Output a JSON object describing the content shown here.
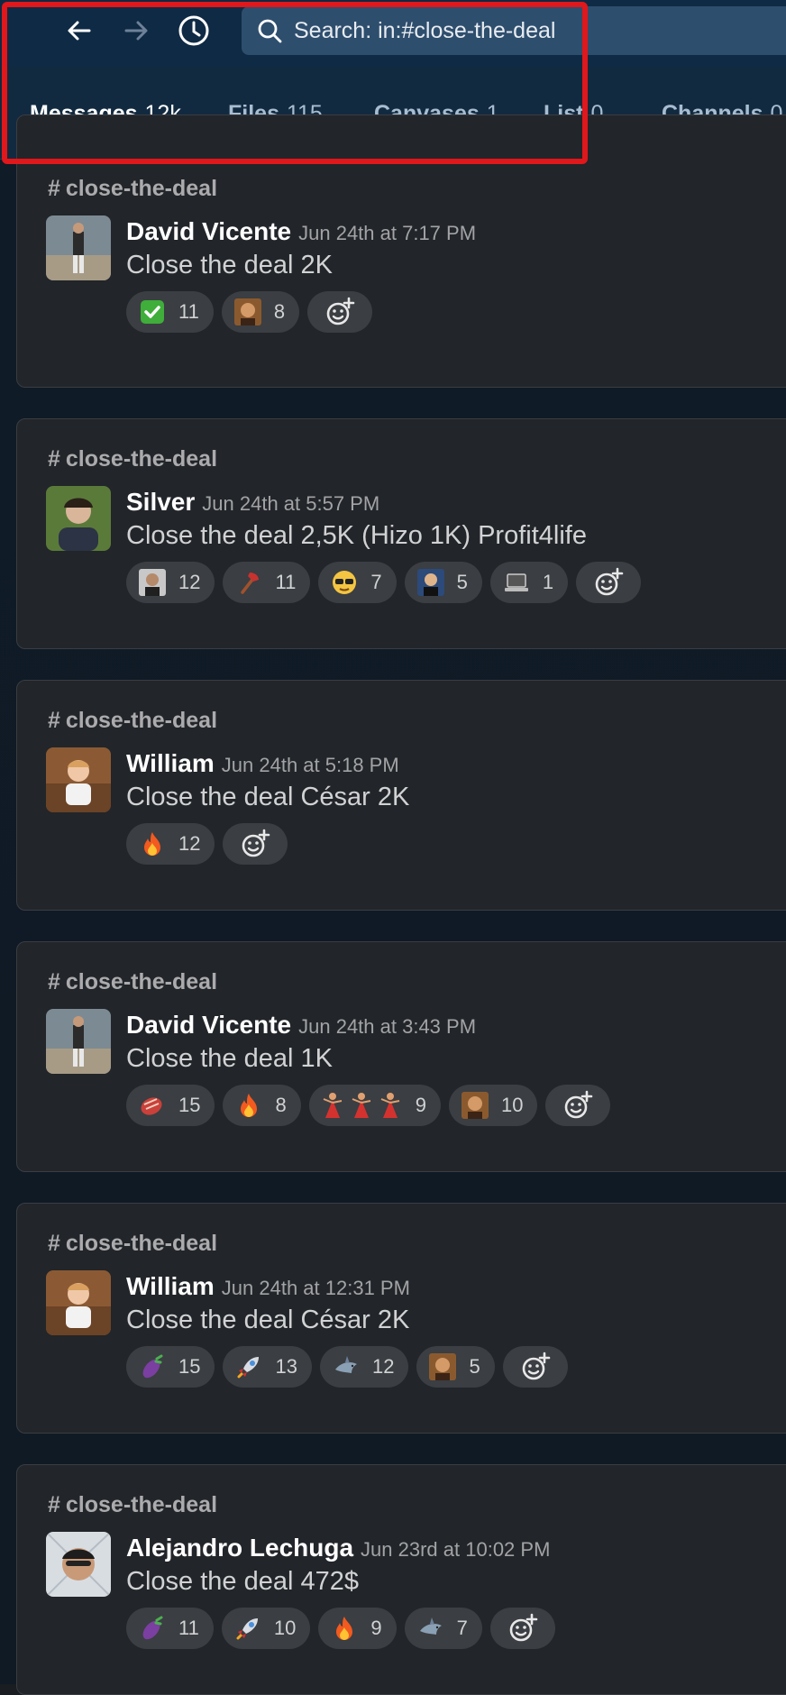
{
  "search": {
    "query": "Search: in:#close-the-deal"
  },
  "tabs": [
    {
      "label": "Messages",
      "count": "12k"
    },
    {
      "label": "Files",
      "count": "115"
    },
    {
      "label": "Canvases",
      "count": "1"
    },
    {
      "label": "List",
      "count": "0"
    },
    {
      "label": "Channels",
      "count": "0"
    }
  ],
  "messages": [
    {
      "channel": "close-the-deal",
      "author": "David Vicente",
      "time": "Jun 24th at 7:17 PM",
      "text": "Close the deal 2K",
      "reactions": [
        {
          "emoji": "white-check-mark",
          "count": "11"
        },
        {
          "emoji": "photo-face",
          "count": "8"
        }
      ]
    },
    {
      "channel": "close-the-deal",
      "author": "Silver",
      "time": "Jun 24th at 5:57 PM",
      "text": "Close the deal 2,5K (Hizo 1K) Profit4life",
      "reactions": [
        {
          "emoji": "photo-face",
          "count": "12"
        },
        {
          "emoji": "axe",
          "count": "11"
        },
        {
          "emoji": "sunglasses",
          "count": "7"
        },
        {
          "emoji": "photo-face",
          "count": "5"
        },
        {
          "emoji": "laptop",
          "count": "1"
        }
      ]
    },
    {
      "channel": "close-the-deal",
      "author": "William",
      "time": "Jun 24th at 5:18 PM",
      "text": "Close the deal César 2K",
      "reactions": [
        {
          "emoji": "fire",
          "count": "12"
        }
      ]
    },
    {
      "channel": "close-the-deal",
      "author": "David Vicente",
      "time": "Jun 24th at 3:43 PM",
      "text": "Close the deal 1K",
      "reactions": [
        {
          "emoji": "meat",
          "count": "15"
        },
        {
          "emoji": "fire",
          "count": "8"
        },
        {
          "emoji": "dancers",
          "count": "9"
        },
        {
          "emoji": "photo-face",
          "count": "10"
        }
      ]
    },
    {
      "channel": "close-the-deal",
      "author": "William",
      "time": "Jun 24th at 12:31 PM",
      "text": "Close the deal César 2K",
      "reactions": [
        {
          "emoji": "eggplant",
          "count": "15"
        },
        {
          "emoji": "rocket",
          "count": "13"
        },
        {
          "emoji": "shark",
          "count": "12"
        },
        {
          "emoji": "photo-face",
          "count": "5"
        }
      ]
    },
    {
      "channel": "close-the-deal",
      "author": "Alejandro Lechuga",
      "time": "Jun 23rd at 10:02 PM",
      "text": "Close the deal 472$",
      "reactions": [
        {
          "emoji": "eggplant",
          "count": "11"
        },
        {
          "emoji": "rocket",
          "count": "10"
        },
        {
          "emoji": "fire",
          "count": "9"
        },
        {
          "emoji": "shark",
          "count": "7"
        }
      ]
    }
  ]
}
